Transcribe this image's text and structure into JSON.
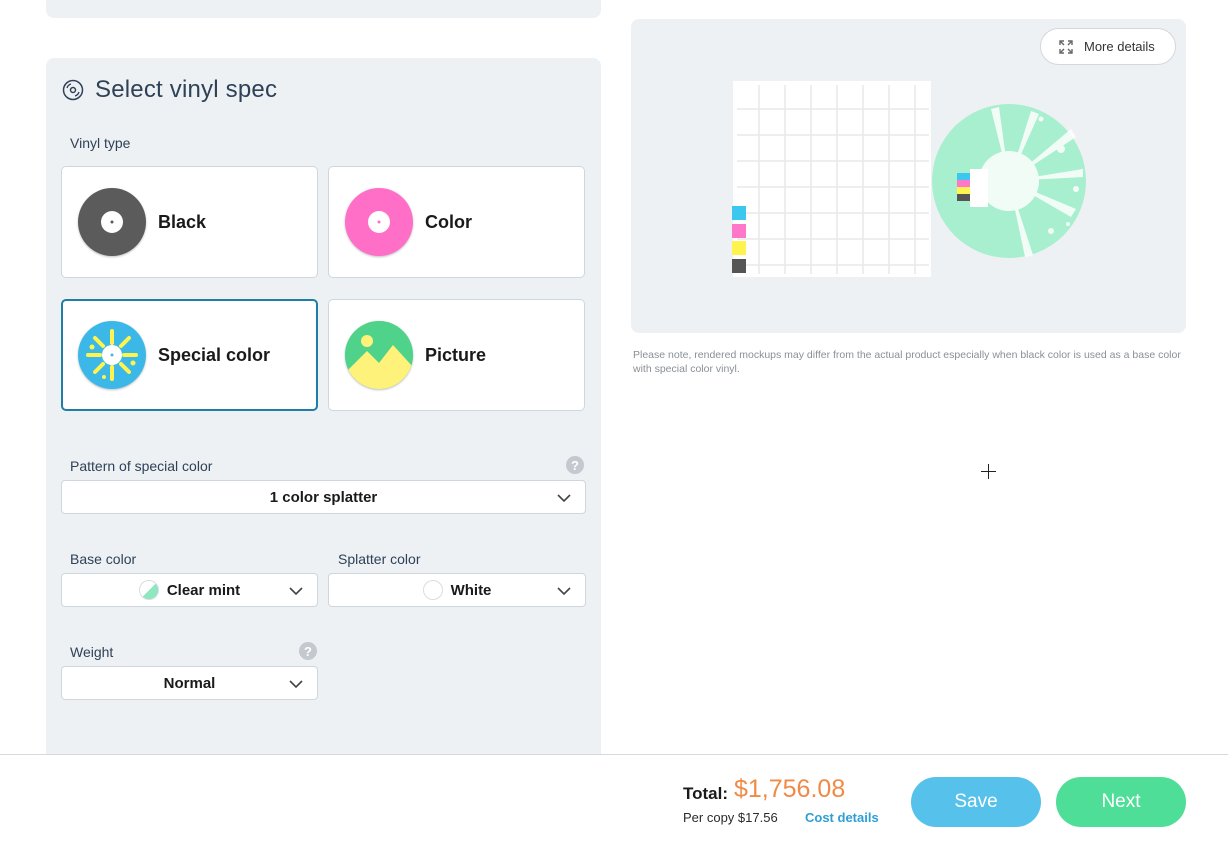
{
  "spec_section": {
    "title": "Select vinyl spec",
    "vinyl_type_label": "Vinyl type",
    "types": [
      {
        "label": "Black",
        "color": "#5b5b5b"
      },
      {
        "label": "Color",
        "color": "#ff6ec7"
      },
      {
        "label": "Special color",
        "color": "#3cb8e8",
        "selected": true
      },
      {
        "label": "Picture",
        "color": "#4fd38b"
      }
    ],
    "pattern": {
      "label": "Pattern of special color",
      "value": "1 color splatter"
    },
    "base_color": {
      "label": "Base color",
      "value": "Clear mint",
      "swatch": "#8ee7c1"
    },
    "splatter_color": {
      "label": "Splatter color",
      "value": "White",
      "swatch": "#ffffff"
    },
    "weight": {
      "label": "Weight",
      "value": "Normal"
    }
  },
  "preview": {
    "more_details_label": "More details",
    "note": "Please note, rendered mockups may differ from the actual product especially when black color is used as a base color with special color vinyl.",
    "disc_color": "#a8efcf",
    "cmyk_colors": [
      "#3cc8ee",
      "#ff77c9",
      "#fff34d",
      "#555555"
    ]
  },
  "footer": {
    "total_label": "Total:",
    "total_value": "$1,756.08",
    "per_copy": "Per copy $17.56",
    "cost_details": "Cost details",
    "save_label": "Save",
    "next_label": "Next"
  }
}
